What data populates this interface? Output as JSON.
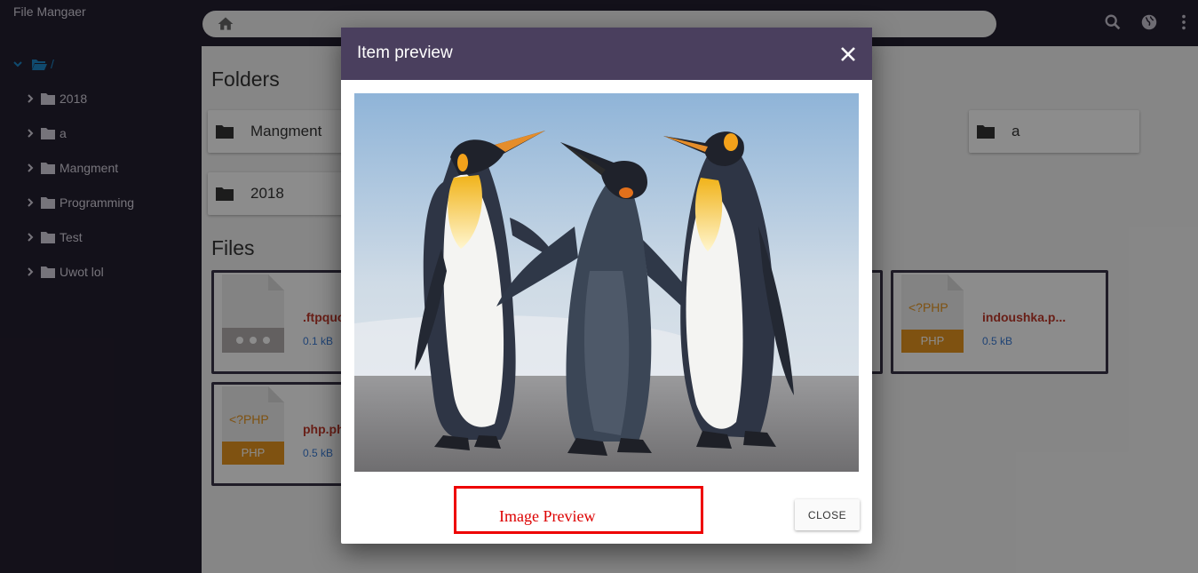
{
  "app": {
    "title": "File Mangaer"
  },
  "sidebar": {
    "root_label": "/",
    "items": [
      {
        "label": "2018"
      },
      {
        "label": "a"
      },
      {
        "label": "Mangment"
      },
      {
        "label": "Programming"
      },
      {
        "label": "Test"
      },
      {
        "label": "Uwot lol"
      }
    ]
  },
  "main": {
    "folders_title": "Folders",
    "files_title": "Files",
    "folders": [
      {
        "label": "Mangment"
      },
      {
        "label": "a"
      },
      {
        "label": "2018"
      }
    ],
    "files": [
      {
        "name": ".ftpquo",
        "size": "0.1 kB",
        "type": "generic"
      },
      {
        "name": "indoushka.p...",
        "size": "0.5 kB",
        "type": "php",
        "code": "<?PHP",
        "badge": "PHP"
      },
      {
        "name": "php.ph",
        "size": "0.5 kB",
        "type": "php",
        "code": "<?PHP",
        "badge": "PHP"
      }
    ]
  },
  "modal": {
    "title": "Item preview",
    "close_button": "CLOSE",
    "annotation": "Image Preview",
    "preview_image": "emperor-penguins"
  },
  "icons": {
    "home": "home-icon",
    "search": "search-icon",
    "globe": "globe-icon",
    "more": "more-vert-icon",
    "close": "close-icon",
    "folder": "folder-icon"
  },
  "colors": {
    "sidebar_bg": "#241f30",
    "modal_header": "#4a3f5e",
    "accent_blue": "#1e88c9",
    "file_name": "#c0392b",
    "php_badge": "#e8951f",
    "annotation": "#e00000"
  }
}
